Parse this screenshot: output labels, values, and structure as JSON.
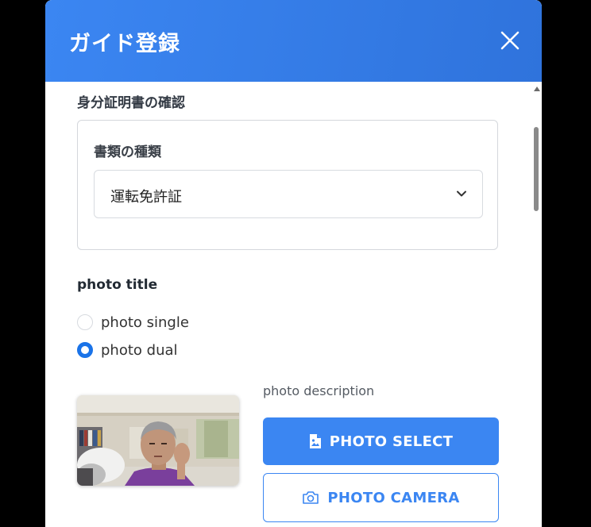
{
  "modal": {
    "title": "ガイド登録",
    "close_icon": "close-icon"
  },
  "identity": {
    "section_title": "身分証明書の確認",
    "doc_type_label": "書類の種類",
    "doc_type_value": "運転免許証"
  },
  "photo": {
    "title": "photo title",
    "options": [
      {
        "label": "photo single",
        "selected": false
      },
      {
        "label": "photo dual",
        "selected": true
      }
    ],
    "description": "photo description",
    "select_button": "PHOTO SELECT",
    "camera_button": "PHOTO CAMERA"
  },
  "colors": {
    "header": "#3b86f2",
    "primary": "#3b86f2",
    "radio_selected": "#1a73e8"
  }
}
